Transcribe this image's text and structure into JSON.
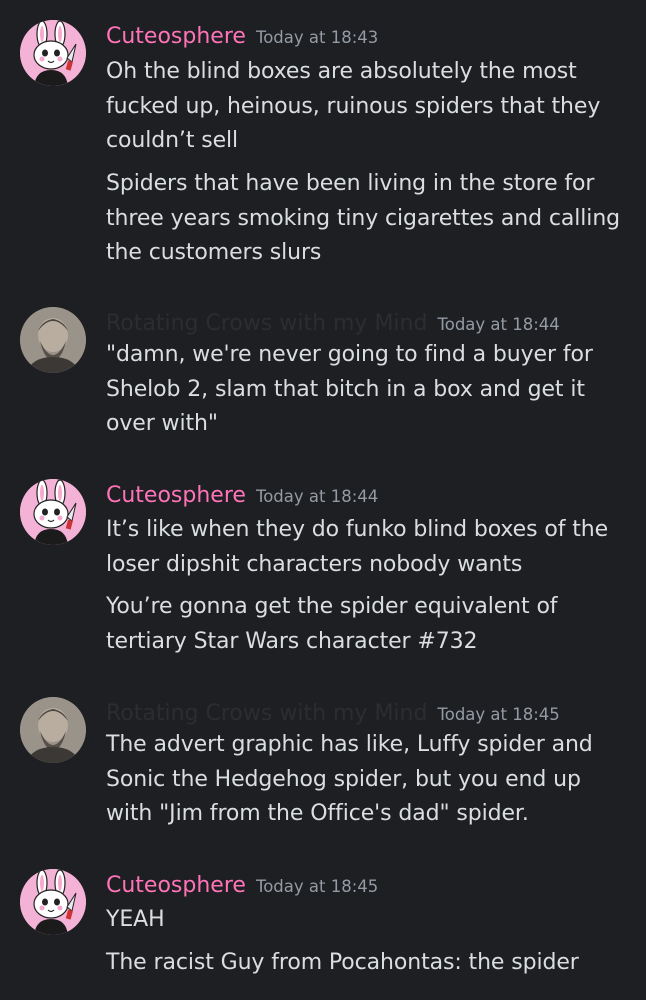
{
  "messages": [
    {
      "author": "Cuteosphere",
      "timestamp": "Today at 18:43",
      "lines": [
        "Oh the blind boxes are absolutely the most fucked up, heinous, ruinous spiders that they couldn’t sell",
        "Spiders that have been living in the store for three years smoking tiny cigarettes and calling the customers slurs"
      ]
    },
    {
      "author": "Rotating Crows with my Mind",
      "timestamp": "Today at 18:44",
      "lines": [
        "\"damn, we're never going to find a buyer for Shelob 2, slam that bitch in a box and get it over with\""
      ]
    },
    {
      "author": "Cuteosphere",
      "timestamp": "Today at 18:44",
      "lines": [
        "It’s like when they do funko blind boxes of the loser dipshit characters nobody wants",
        "You’re gonna get the spider equivalent of tertiary Star Wars character #732"
      ]
    },
    {
      "author": "Rotating Crows with my Mind",
      "timestamp": "Today at 18:45",
      "lines": [
        "The advert graphic has like, Luffy spider and Sonic the Hedgehog spider, but you end up with \"Jim from the Office's dad\" spider."
      ]
    },
    {
      "author": "Cuteosphere",
      "timestamp": "Today at 18:45",
      "lines": [
        "YEAH",
        "The racist Guy from Pocahontas: the spider"
      ]
    }
  ]
}
